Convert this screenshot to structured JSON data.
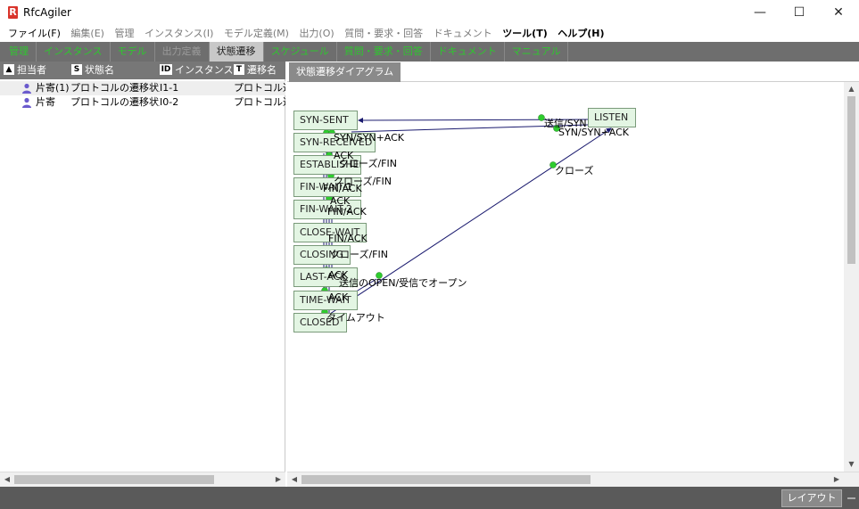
{
  "window": {
    "title": "RfcAgiler",
    "logo_letter": "R",
    "minimize": "—",
    "maximize": "☐",
    "close": "✕"
  },
  "menu": [
    {
      "label": "ファイル(F)",
      "disabled": false,
      "bold": false
    },
    {
      "label": "編集(E)",
      "disabled": true,
      "bold": false
    },
    {
      "label": "管理",
      "disabled": true,
      "bold": false
    },
    {
      "label": "インスタンス(I)",
      "disabled": true,
      "bold": false
    },
    {
      "label": "モデル定義(M)",
      "disabled": true,
      "bold": false
    },
    {
      "label": "出力(O)",
      "disabled": true,
      "bold": false
    },
    {
      "label": "質問・要求・回答",
      "disabled": true,
      "bold": false
    },
    {
      "label": "ドキュメント",
      "disabled": true,
      "bold": false
    },
    {
      "label": "ツール(T)",
      "disabled": false,
      "bold": true
    },
    {
      "label": "ヘルプ(H)",
      "disabled": false,
      "bold": true
    }
  ],
  "tabs": [
    {
      "label": "管理",
      "style": "green"
    },
    {
      "label": "インスタンス",
      "style": "green"
    },
    {
      "label": "モデル",
      "style": "green"
    },
    {
      "label": "出力定義",
      "style": "dim"
    },
    {
      "label": "状態遷移",
      "style": "active"
    },
    {
      "label": "スケジュール",
      "style": "green"
    },
    {
      "label": "質問・要求・回答",
      "style": "green"
    },
    {
      "label": "ドキュメント",
      "style": "green"
    },
    {
      "label": "マニュアル",
      "style": "green"
    }
  ],
  "list": {
    "columns": [
      {
        "icon": "person-icon",
        "glyph": "▲",
        "label": "担当者"
      },
      {
        "icon": "s-icon",
        "glyph": "S",
        "label": "状態名"
      },
      {
        "icon": "id-icon",
        "glyph": "ID",
        "label": "インスタンスID"
      },
      {
        "icon": "t-icon",
        "glyph": "T",
        "label": "遷移名"
      }
    ],
    "rows": [
      {
        "owner": "片寄(1)",
        "state": "プロトコルの遷移状態",
        "id": "I1-1",
        "transition": "プロトコル遷移",
        "selected": true
      },
      {
        "owner": "片寄",
        "state": "プロトコルの遷移状態",
        "id": "I0-2",
        "transition": "プロトコル遷移",
        "selected": false
      }
    ]
  },
  "diagram": {
    "tab_label": "状態遷移ダイアグラム",
    "states": [
      "SYN-SENT",
      "SYN-RECEIVED",
      "ESTABLISHED",
      "FIN-WAIT-1",
      "FIN-WAIT-2",
      "CLOSE-WAIT",
      "CLOSING",
      "LAST-ACK",
      "TIME-WAIT",
      "CLOSED",
      "LISTEN"
    ],
    "labels": [
      "送信/SYN",
      "SYN/SYN+ACK",
      "SYN/SYN+ACK",
      "ACK",
      "クローズ/FIN",
      "クローズ/FIN",
      "FIN/ACK",
      "ACK",
      "FIN/ACK",
      "FIN/ACK",
      "クローズ/FIN",
      "ACK",
      "送信のOPEN/受信でオープン",
      "ACK",
      "タイムアウト",
      "クローズ"
    ]
  },
  "status": {
    "layout_button": "レイアウト"
  },
  "colors": {
    "tab_green": "#2fc62f",
    "state_fill": "#e3f5e3",
    "node_dot": "#2ecc2e",
    "edge": "#1a1a6e"
  }
}
